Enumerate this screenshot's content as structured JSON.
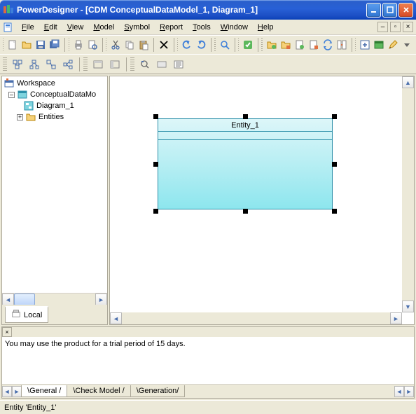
{
  "window": {
    "title": "PowerDesigner - [CDM ConceptualDataModel_1, Diagram_1]"
  },
  "menubar": {
    "file": "File",
    "edit": "Edit",
    "view": "View",
    "model": "Model",
    "symbol": "Symbol",
    "report": "Report",
    "tools": "Tools",
    "window": "Window",
    "help": "Help"
  },
  "tree": {
    "root": "Workspace",
    "model": "ConceptualDataMo",
    "diagram": "Diagram_1",
    "entities": "Entities"
  },
  "sidebar": {
    "local_tab": "Local"
  },
  "canvas": {
    "entity_name": "Entity_1"
  },
  "output": {
    "message": "You may use the product for a trial period of 15 days.",
    "tabs": {
      "general": "General",
      "check": "Check Model",
      "gen": "Generation"
    }
  },
  "statusbar": {
    "text": "Entity 'Entity_1'"
  }
}
